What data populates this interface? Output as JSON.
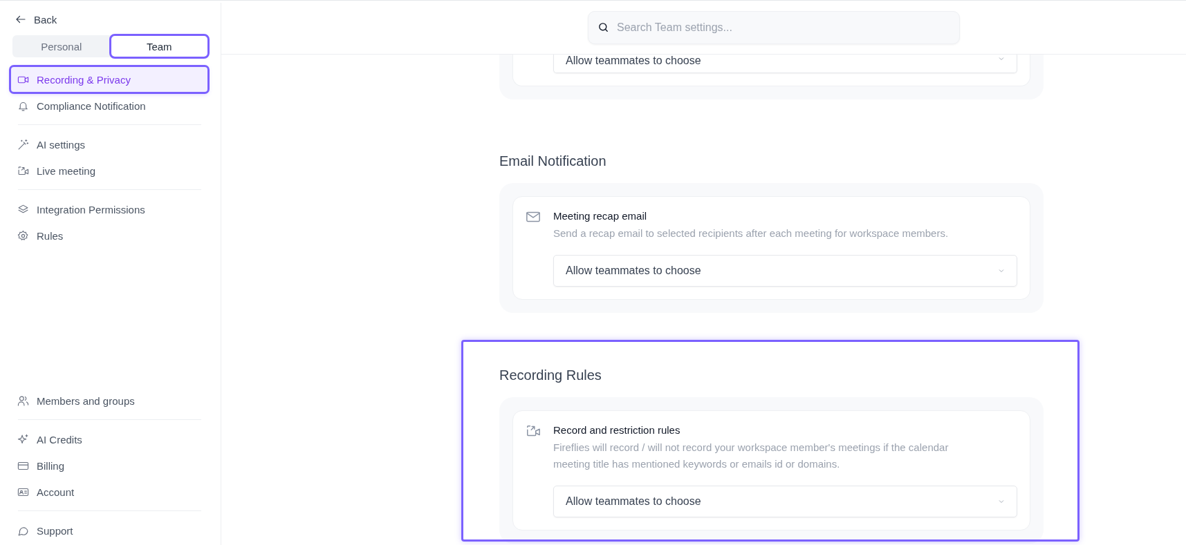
{
  "sidebar": {
    "back": "Back",
    "tabs": [
      {
        "label": "Personal",
        "selected": false,
        "highlighted": false
      },
      {
        "label": "Team",
        "selected": true,
        "highlighted": true
      }
    ],
    "groups": [
      [
        {
          "label": "Recording & Privacy",
          "selected": true,
          "highlighted": true
        },
        {
          "label": "Compliance Notification",
          "selected": false,
          "highlighted": false
        }
      ],
      [
        {
          "label": "AI settings",
          "selected": false,
          "highlighted": false
        },
        {
          "label": "Live meeting",
          "selected": false,
          "highlighted": false
        }
      ],
      [
        {
          "label": "Integration Permissions",
          "selected": false,
          "highlighted": false
        },
        {
          "label": "Rules",
          "selected": false,
          "highlighted": false
        }
      ]
    ],
    "bottom_groups": [
      [
        {
          "label": "Members and groups",
          "selected": false,
          "highlighted": false
        }
      ],
      [
        {
          "label": "AI Credits",
          "selected": false,
          "highlighted": false
        },
        {
          "label": "Billing",
          "selected": false,
          "highlighted": false
        },
        {
          "label": "Account",
          "selected": false,
          "highlighted": false
        }
      ],
      [
        {
          "label": "Support",
          "selected": false,
          "highlighted": false
        }
      ]
    ]
  },
  "search": {
    "placeholder": "Search Team settings..."
  },
  "sections": [
    {
      "settings": [
        {
          "value": "Allow teammates to choose"
        }
      ]
    },
    {
      "heading": "Email Notification",
      "settings": [
        {
          "title": "Meeting recap email",
          "description": "Send a recap email to selected recipients after each meeting for workspace members.",
          "value": "Allow teammates to choose"
        }
      ]
    },
    {
      "heading": "Recording Rules",
      "highlighted": true,
      "settings": [
        {
          "title": "Record and restriction rules",
          "description": "Fireflies will record / will not record your workspace member's meetings if the calendar meeting title has mentioned keywords or emails id or domains.",
          "value": "Allow teammates to choose"
        }
      ]
    }
  ]
}
